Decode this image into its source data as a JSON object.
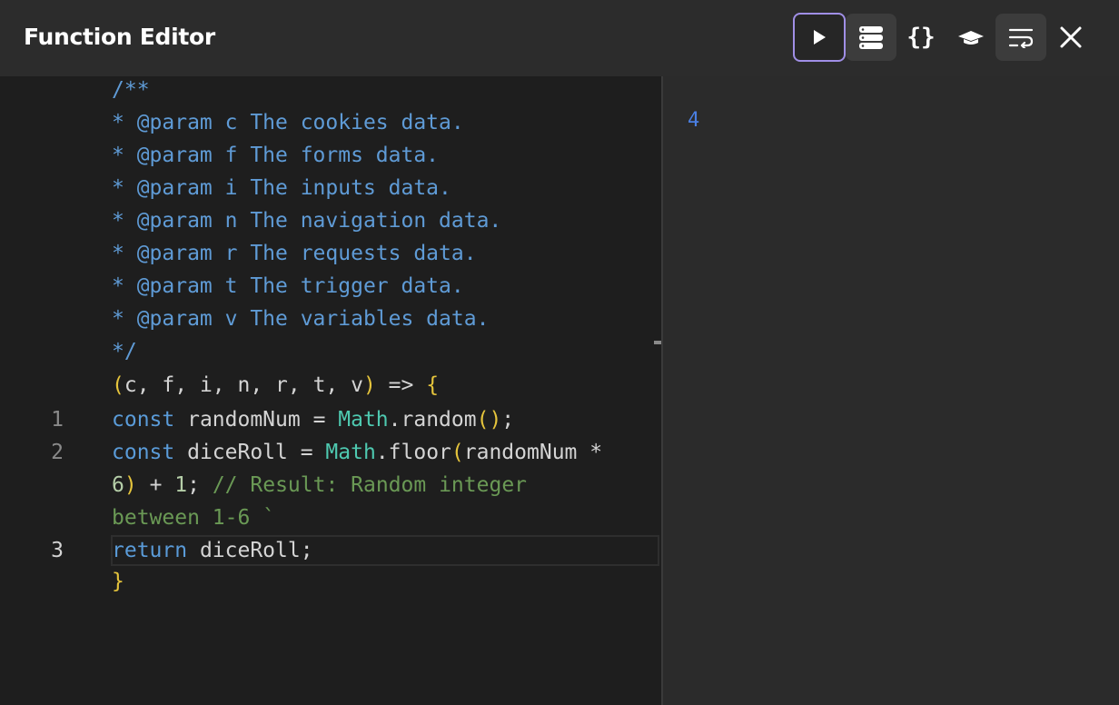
{
  "header": {
    "title": "Function Editor",
    "buttons": {
      "run_icon": "play-icon",
      "data_icon": "database-icon",
      "format_icon": "braces-icon",
      "format_label": "{}",
      "ai_icon": "cap-icon",
      "wrap_icon": "word-wrap-icon",
      "close_icon": "close-icon"
    }
  },
  "editor": {
    "doc_comment": [
      "/**",
      "* @param c The cookies data.",
      "* @param f The forms data.",
      "* @param i The inputs data.",
      "* @param n The navigation data.",
      "* @param r The requests data.",
      "* @param t The trigger data.",
      "* @param v The variables data.",
      "*/"
    ],
    "signature": {
      "open_paren": "(",
      "params": "c, f, i, n, r, t, v",
      "close_paren": ")",
      "arrow": " => ",
      "open_brace": "{"
    },
    "line_numbers": [
      "1",
      "2",
      "3"
    ],
    "code": {
      "l1_kw": "const",
      "l1_var": " randomNum = ",
      "l1_cls": "Math",
      "l1_call": ".random",
      "l1_parens": "()",
      "l1_end": ";",
      "l2_kw": "const",
      "l2_var": " diceRoll = ",
      "l2_cls": "Math",
      "l2_call": ".floor",
      "l2_open": "(",
      "l2_arg": "randomNum *",
      "l2b_num": "6",
      "l2b_close": ")",
      "l2b_plus": " + ",
      "l2b_one": "1",
      "l2b_semi": "; ",
      "l2b_comment": "// Result: Random integer",
      "l2c_comment": "between 1-6 `",
      "l3_kw": "return",
      "l3_rest": " diceRoll;",
      "close_brace": "}"
    }
  },
  "output": {
    "value": "4"
  },
  "colors": {
    "accent": "#a08fe6",
    "doc_comment": "#5f9bd6",
    "keyword": "#5a9bd8",
    "class": "#4ec9b0",
    "bracket": "#e5c43c",
    "comment": "#6a9955",
    "output_value": "#4a7fe3"
  }
}
